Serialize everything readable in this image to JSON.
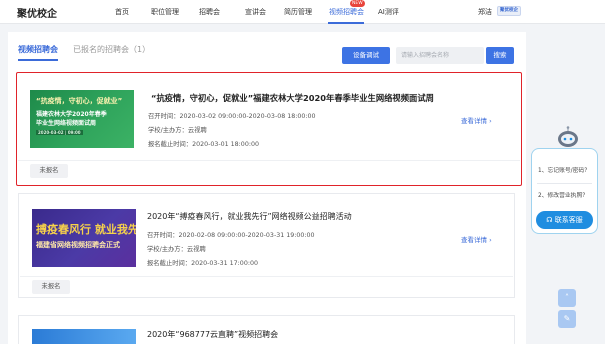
{
  "brand": "聚优校企",
  "nav": {
    "items": [
      "首页",
      "职位管理",
      "招聘会",
      "宣讲会",
      "简历管理",
      "视频招聘会",
      "AI测评"
    ],
    "new_badge": "NEW",
    "user": "郑洁",
    "user_logo": "聚优校企"
  },
  "tabs": {
    "active": "视频招聘会",
    "inactive": "已报名的招聘会（1）"
  },
  "toolbar": {
    "debug_label": "设备调试",
    "search_placeholder": "请输入招聘会名称",
    "search_label": "搜索"
  },
  "cards": [
    {
      "title": "“抗疫情，守初心，促就业”福建农林大学2020年春季毕业生网络视频面试周",
      "meeting_time": "召开时间：2020-03-02 09:00:00-2020-03-08 18:00:00",
      "host": "学校/主办方：云视聘",
      "deadline": "报名截止时间：2020-03-01 18:00:00",
      "detail": "查看详情",
      "status": "未报名",
      "thumb_lines": [
        "“抗疫情，守初心，促就业”",
        "福建农林大学2020年春季",
        "毕业生网络视频面试周",
        "2020-03-02 | 09:00"
      ]
    },
    {
      "title": "2020年“搏疫春风行，就业我先行”网络视频公益招聘活动",
      "meeting_time": "召开时间：2020-02-08 09:00:00-2020-03-31 19:00:00",
      "host": "学校/主办方：云视聘",
      "deadline": "报名截止时间：2020-03-31 17:00:00",
      "detail": "查看详情",
      "status": "未报名",
      "thumb_lines": [
        "搏疫春风行 就业我先",
        "福建省网络视频招聘会正式"
      ]
    },
    {
      "title": "2020年“968777云直聘”视频招聘会"
    }
  ],
  "help": {
    "q1": "1、忘记账号/密码？",
    "q2": "2、修改营业执照？",
    "contact": "联系客服"
  },
  "colors": {
    "accent": "#3b6bd9",
    "highlight_border": "#e0232a",
    "help_button": "#1f8de0"
  }
}
